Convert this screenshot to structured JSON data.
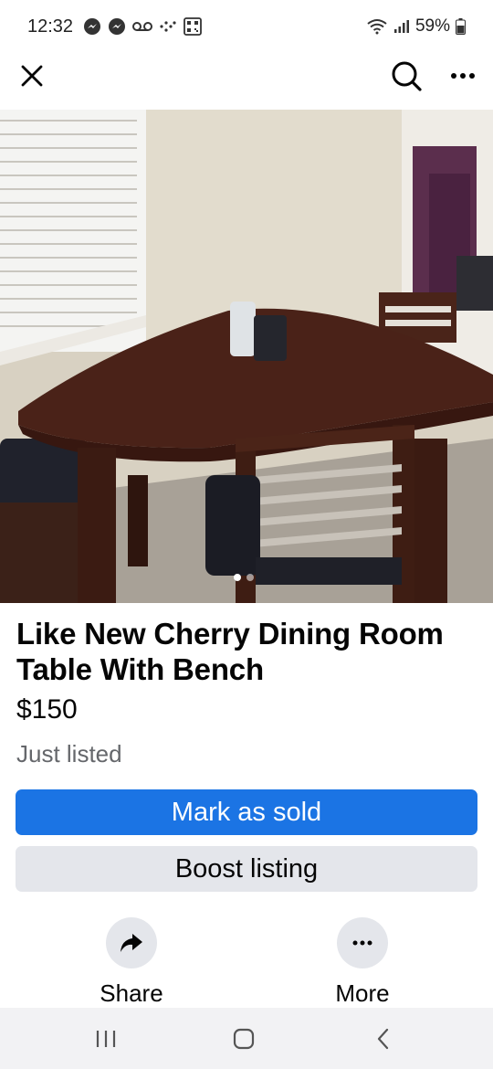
{
  "status_bar": {
    "time": "12:32",
    "battery": "59%",
    "icons": [
      "messenger-icon",
      "messenger-icon",
      "voicemail-icon",
      "dots-icon",
      "qr-icon",
      "wifi-icon",
      "signal-icon",
      "battery-icon"
    ]
  },
  "header": {
    "close_icon": "close-icon",
    "search_icon": "search-icon",
    "more_icon": "more-horizontal-icon"
  },
  "photo": {
    "image_count": 2,
    "active_index": 1
  },
  "listing": {
    "title": "Like New Cherry Dining Room Table With Bench",
    "price": "$150",
    "status": "Just listed"
  },
  "buttons": {
    "mark_sold": "Mark as sold",
    "boost": "Boost listing"
  },
  "actions": {
    "share": "Share",
    "more": "More"
  },
  "colors": {
    "primary": "#1b74e4",
    "secondary_bg": "#e4e6eb",
    "muted_text": "#65676b"
  },
  "nav_bar": {
    "icons": [
      "recents-icon",
      "home-icon",
      "back-icon"
    ]
  }
}
